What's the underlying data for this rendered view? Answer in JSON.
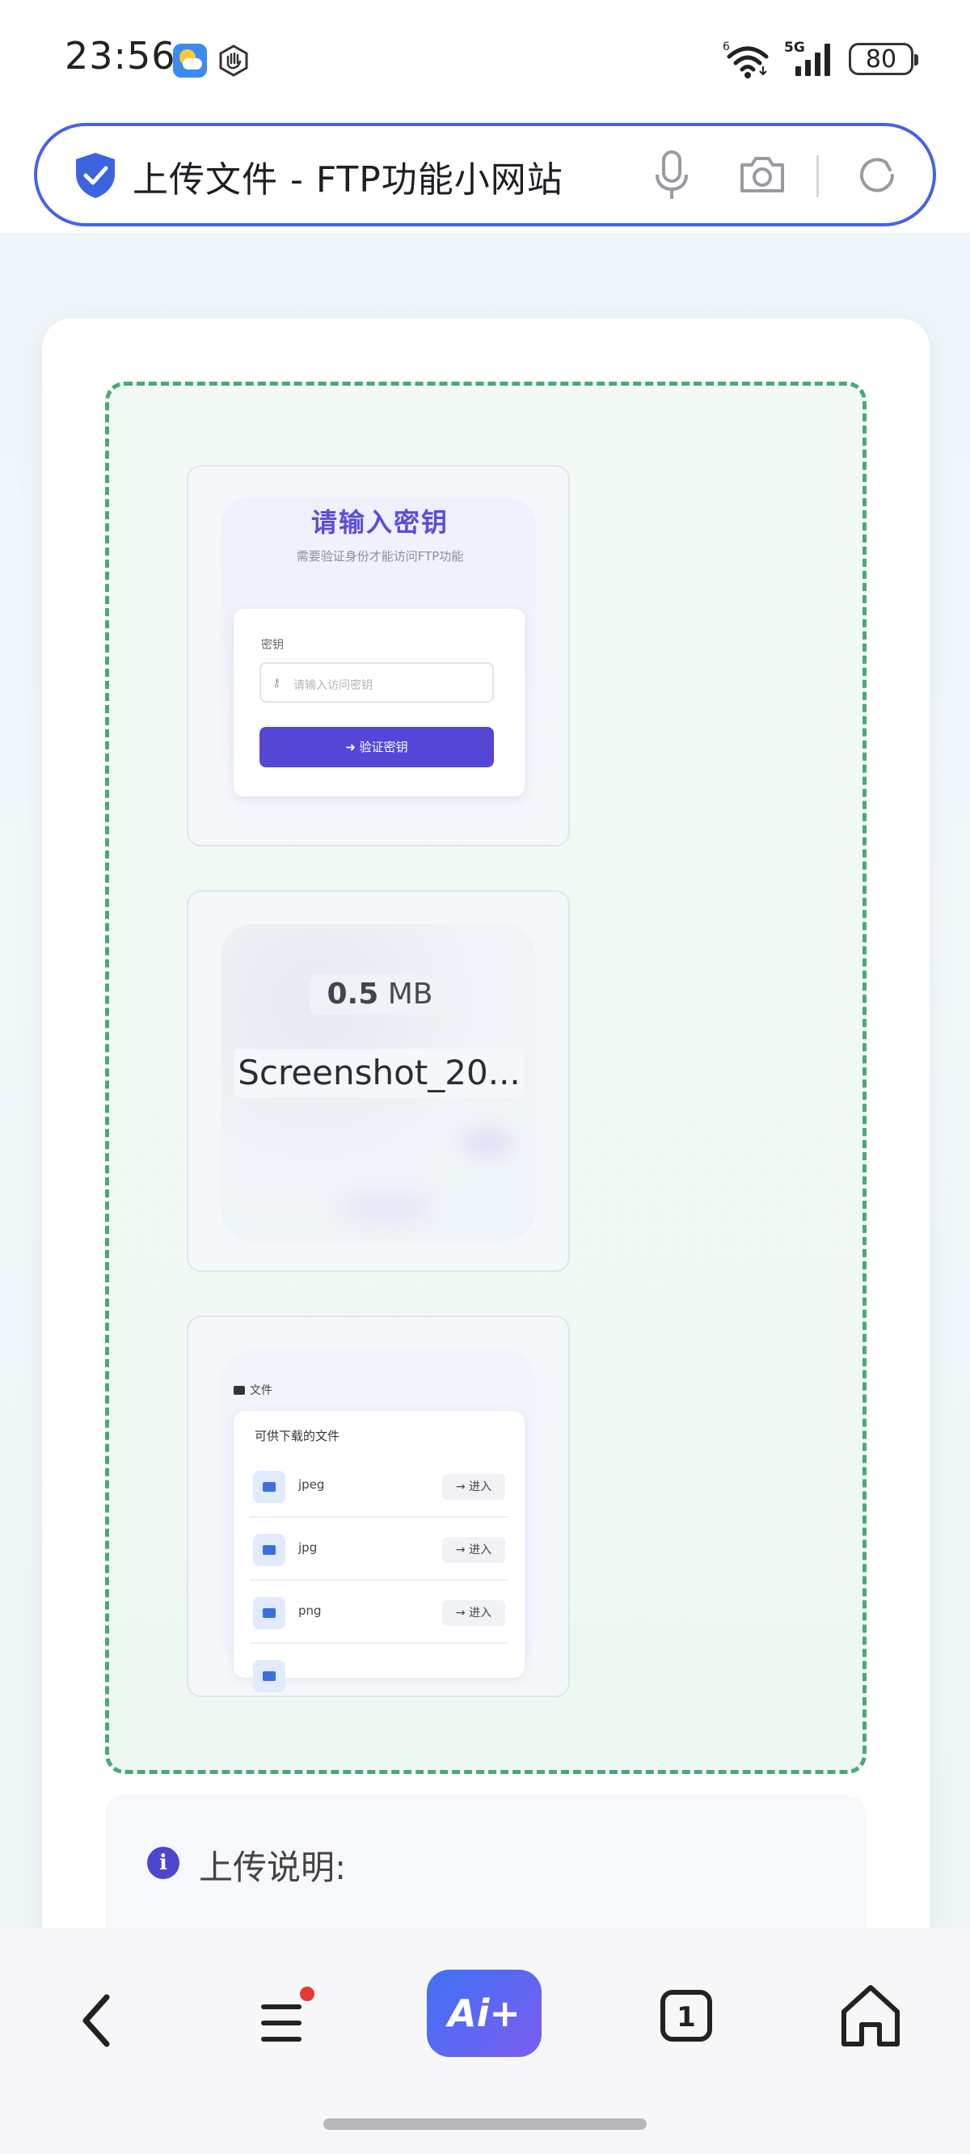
{
  "status_bar": {
    "time": "23:56",
    "network": "5G",
    "battery": "80"
  },
  "address_bar": {
    "title": "上传文件 - FTP功能小网站"
  },
  "dropzone": {
    "previews": [
      {
        "title": "请输入密钥",
        "subtitle": "需要验证身份才能访问FTP功能",
        "field_label": "密钥",
        "field_placeholder": "请输入访问密钥",
        "button_label": "验证密钥"
      },
      {
        "size_value": "0.5",
        "size_unit": "MB",
        "file_name": "Screenshot_20..."
      },
      {
        "header": "文件",
        "panel_title": "可供下载的文件",
        "rows": [
          {
            "name": "jpeg",
            "action": "进入"
          },
          {
            "name": "jpg",
            "action": "进入"
          },
          {
            "name": "png",
            "action": "进入"
          }
        ]
      }
    ]
  },
  "notice": {
    "title": "上传说明:"
  },
  "bottom_nav": {
    "ai_label": "Ai+",
    "tab_count": "1"
  },
  "colors": {
    "accent": "#4662e8",
    "dropzone_border": "#4aa878",
    "primary_button": "#5447d8"
  }
}
